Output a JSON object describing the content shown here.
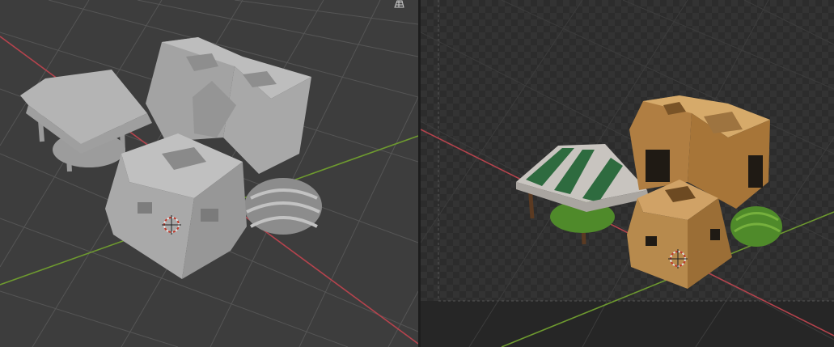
{
  "viewports": {
    "left": {
      "shading": "solid",
      "background": "#3d3d3d"
    },
    "right": {
      "shading": "rendered",
      "background": "#2b2b2b"
    }
  },
  "colors": {
    "x_axis": "#b5434d",
    "y_axis": "#6e9a2f",
    "grid_left": "#545454",
    "grid_right": "#3c3c3c",
    "clay": "#b98a4e",
    "awning_green": "#2e6b3f",
    "plant_green": "#4f8a2a"
  },
  "icons": {
    "overlay_toggle": "grid-overlay-icon",
    "cursor": "3d-cursor-icon"
  },
  "scene_objects": [
    "market-stall",
    "mud-brick-house-large",
    "mud-brick-house-small",
    "hay-bundles"
  ]
}
